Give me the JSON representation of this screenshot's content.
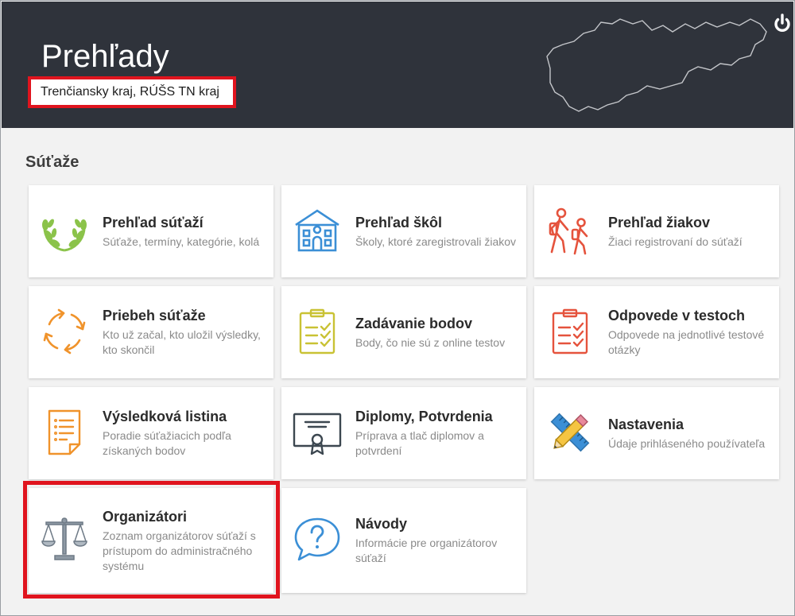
{
  "header": {
    "title": "Prehľady",
    "region": "Trenčiansky kraj, RÚŠS TN kraj"
  },
  "section": {
    "title": "Súťaže"
  },
  "cards": [
    {
      "title": "Prehľad súťaží",
      "desc": "Súťaže, termíny, kategórie, kolá",
      "icon": "laurel-wreath-icon"
    },
    {
      "title": "Prehľad škôl",
      "desc": "Školy, ktoré zaregistrovali žiakov",
      "icon": "school-building-icon"
    },
    {
      "title": "Prehľad žiakov",
      "desc": "Žiaci registrovaní do súťaží",
      "icon": "students-walking-icon"
    },
    {
      "title": "Priebeh súťaže",
      "desc": "Kto už začal, kto uložil výsledky, kto skončil",
      "icon": "refresh-arrows-icon"
    },
    {
      "title": "Zadávanie bodov",
      "desc": "Body, čo nie sú z online testov",
      "icon": "clipboard-check-icon"
    },
    {
      "title": "Odpovede v testoch",
      "desc": "Odpovede na jednotlivé testové otázky",
      "icon": "clipboard-check-icon"
    },
    {
      "title": "Výsledková listina",
      "desc": "Poradie súťažiacich podľa získaných bodov",
      "icon": "document-list-icon"
    },
    {
      "title": "Diplomy, Potvrdenia",
      "desc": "Príprava a tlač diplomov a potvrdení",
      "icon": "certificate-icon"
    },
    {
      "title": "Nastavenia",
      "desc": "Údaje prihláseného používateľa",
      "icon": "ruler-pencil-icon"
    },
    {
      "title": "Organizátori",
      "desc": "Zoznam organizátorov súťaží s prístupom do administračného systému",
      "icon": "scales-icon"
    },
    {
      "title": "Návody",
      "desc": "Informácie pre organizátorov súťaží",
      "icon": "question-bubble-icon"
    }
  ],
  "colors": {
    "header_bg": "#2f333b",
    "highlight": "#e0141e",
    "green": "#8bc34a",
    "blue": "#3b8fd6",
    "red": "#e5533d",
    "orange": "#f0932b",
    "yellow": "#c9c234",
    "dark": "#3c4750",
    "gray": "#8f9aa5"
  }
}
